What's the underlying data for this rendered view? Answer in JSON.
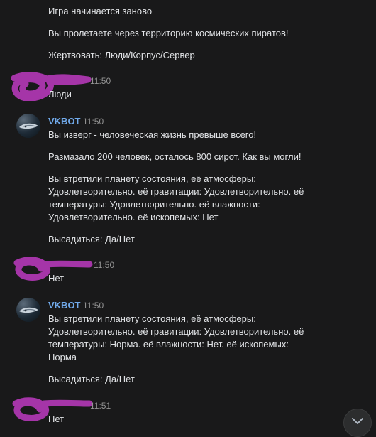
{
  "messages": {
    "m1": {
      "lines": [
        "Игра начинается заново",
        "Вы пролетаете через территорию космических пиратов!",
        "Жертвовать: Люди/Корпус/Сервер"
      ]
    },
    "m2": {
      "time": "11:50",
      "lines": [
        "Люди"
      ]
    },
    "m3": {
      "author": "VKBOT",
      "time": "11:50",
      "lines": [
        "Вы изверг - человеческая жизнь превыше всего!",
        "Размазало 200 человек, осталось 800 сирот. Как вы могли!",
        "Вы втретили планету состояния, её атмосферы:",
        "Удовлетворительно. её гравитации: Удовлетворительно. её",
        "температуры: Удовлетворительно. её влажности:",
        "Удовлетворительно. её ископемых: Нет",
        "Высадиться: Да/Нет"
      ]
    },
    "m4": {
      "time": "11:50",
      "lines": [
        "Нет"
      ]
    },
    "m5": {
      "author": "VKBOT",
      "time": "11:50",
      "lines": [
        "Вы втретили планету состояния, её атмосферы:",
        "Удовлетворительно. её гравитации: Удовлетворительно. её",
        "температуры: Норма. её влажности: Нет. её ископемых:",
        "Норма",
        "Высадиться: Да/Нет"
      ]
    },
    "m6": {
      "time": "11:51",
      "lines": [
        "Нет"
      ]
    }
  },
  "colors": {
    "background": "#19191a",
    "text": "#e1e3e6",
    "author": "#71aaeb",
    "time": "#939393",
    "redaction": "#a535a8"
  },
  "icons": {
    "bot_avatar": "spaceship-avatar-icon",
    "scroll": "chevron-down-icon"
  }
}
